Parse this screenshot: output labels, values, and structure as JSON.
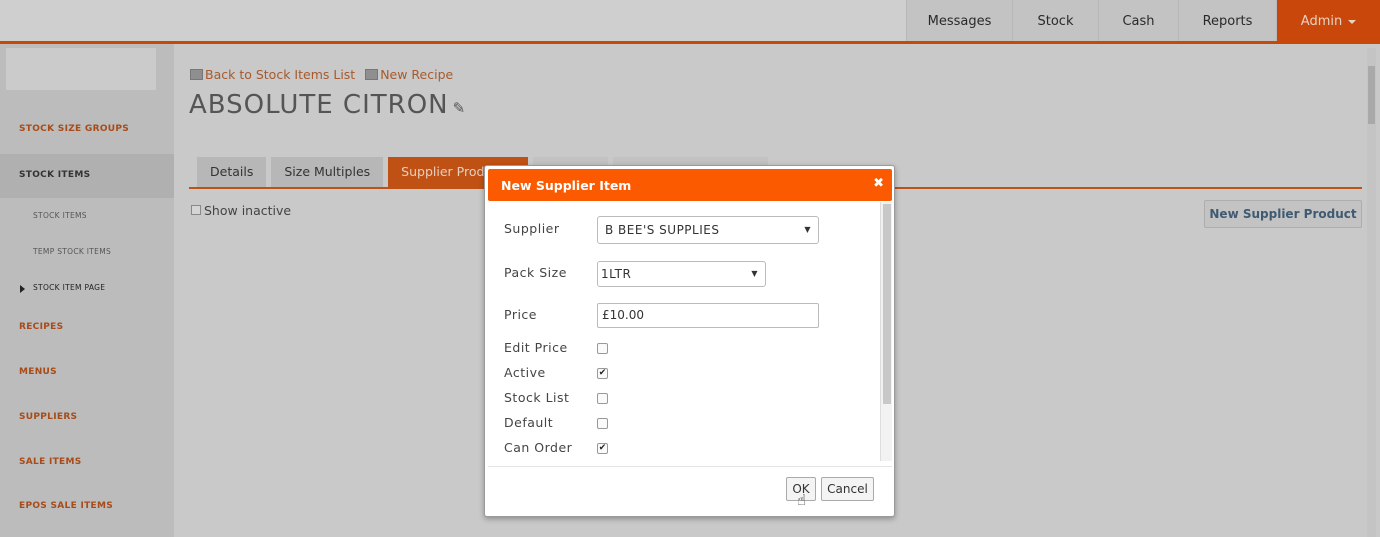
{
  "topnav": {
    "items": [
      "Messages",
      "Stock",
      "Cash",
      "Reports",
      "Admin"
    ]
  },
  "sidebar": {
    "items": [
      {
        "label": "STOCK SIZE GROUPS"
      },
      {
        "label": "STOCK ITEMS"
      },
      {
        "label": "STOCK ITEMS"
      },
      {
        "label": "TEMP STOCK ITEMS"
      },
      {
        "label": "STOCK ITEM PAGE"
      },
      {
        "label": "RECIPES"
      },
      {
        "label": "MENUS"
      },
      {
        "label": "SUPPLIERS"
      },
      {
        "label": "SALE ITEMS"
      },
      {
        "label": "EPOS SALE ITEMS"
      }
    ]
  },
  "breadcrumb": {
    "back_label": "Back to Stock Items List",
    "new_recipe_label": "New Recipe"
  },
  "page": {
    "title": "ABSOLUTE CITRON"
  },
  "tabs": [
    "Details",
    "Size Multiples",
    "Supplier Products"
  ],
  "filter": {
    "show_inactive_label": "Show inactive"
  },
  "actions": {
    "new_supplier_product_label": "New Supplier Product"
  },
  "modal": {
    "title": "New Supplier Item",
    "close_glyph": "✖",
    "fields": {
      "supplier_label": "Supplier",
      "supplier_value": "B BEE'S SUPPLIES",
      "pack_size_label": "Pack Size",
      "pack_size_value": "1LTR",
      "price_label": "Price",
      "price_value": "£10.00",
      "edit_price_label": "Edit Price",
      "active_label": "Active",
      "stock_list_label": "Stock List",
      "default_label": "Default",
      "can_order_label": "Can Order"
    },
    "checkbox_glyph": "✔",
    "ok_label": "OK",
    "cancel_label": "Cancel"
  },
  "colors": {
    "accent": "#c05114",
    "modal_header": "#fb5a00",
    "link": "#a65a2e"
  },
  "icons": [
    "pencil-icon",
    "close-icon",
    "hand-cursor-icon",
    "chevron-down-icon",
    "stock-list-icon",
    "recipe-icon"
  ]
}
